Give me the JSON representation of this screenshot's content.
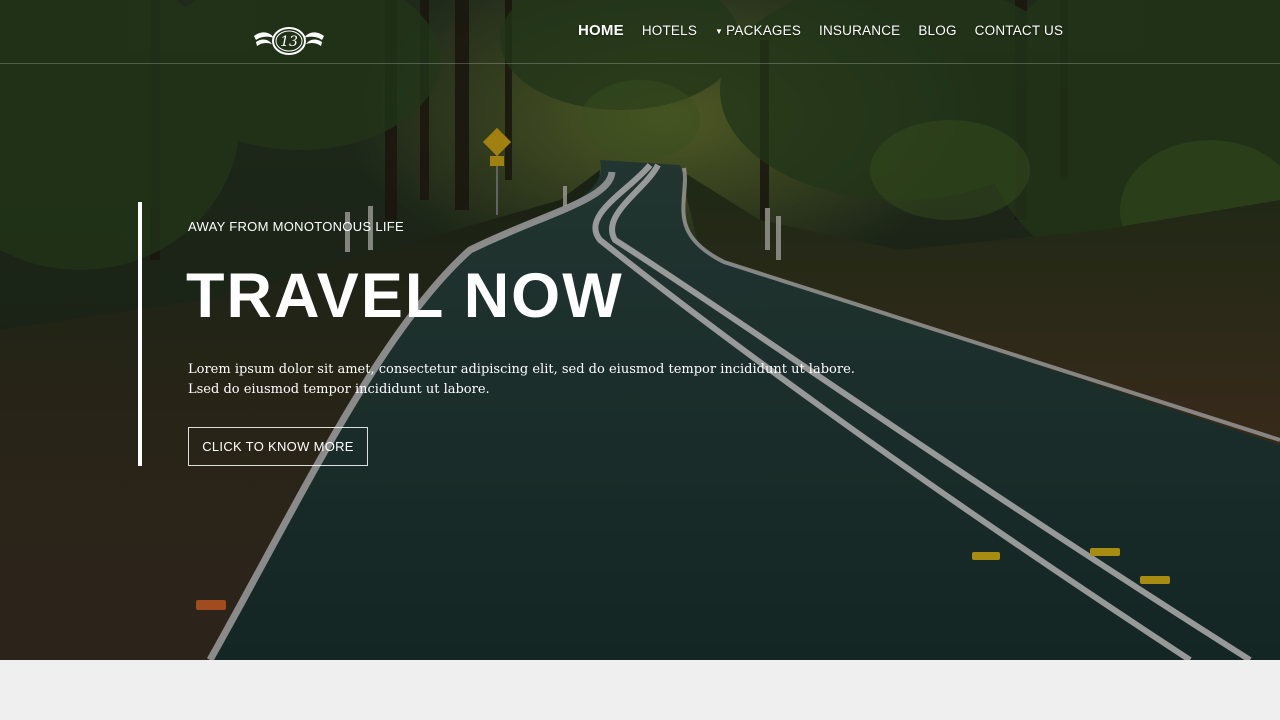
{
  "nav": {
    "items": [
      {
        "label": "HOME",
        "active": true
      },
      {
        "label": "HOTELS",
        "active": false
      },
      {
        "label": "PACKAGES",
        "active": false,
        "has_dropdown": true
      },
      {
        "label": "INSURANCE",
        "active": false
      },
      {
        "label": "BLOG",
        "active": false
      },
      {
        "label": "CONTACT US",
        "active": false
      }
    ]
  },
  "logo": {
    "text": "13"
  },
  "hero": {
    "eyebrow": "AWAY FROM MONOTONOUS LIFE",
    "headline": "TRAVEL NOW",
    "body_line1": "Lorem ipsum dolor sit amet, consectetur adipiscing elit, sed do eiusmod tempor incididunt ut labore.",
    "body_line2": "Lsed do eiusmod tempor incididunt ut labore.",
    "cta_label": "CLICK TO KNOW MORE"
  },
  "icons": {
    "logo": "winged-emblem-icon",
    "dropdown": "caret-down-icon"
  },
  "colors": {
    "text": "#ffffff",
    "road": "#1f3a36",
    "forest": "#1f3a1c",
    "page_bg": "#efefef"
  }
}
